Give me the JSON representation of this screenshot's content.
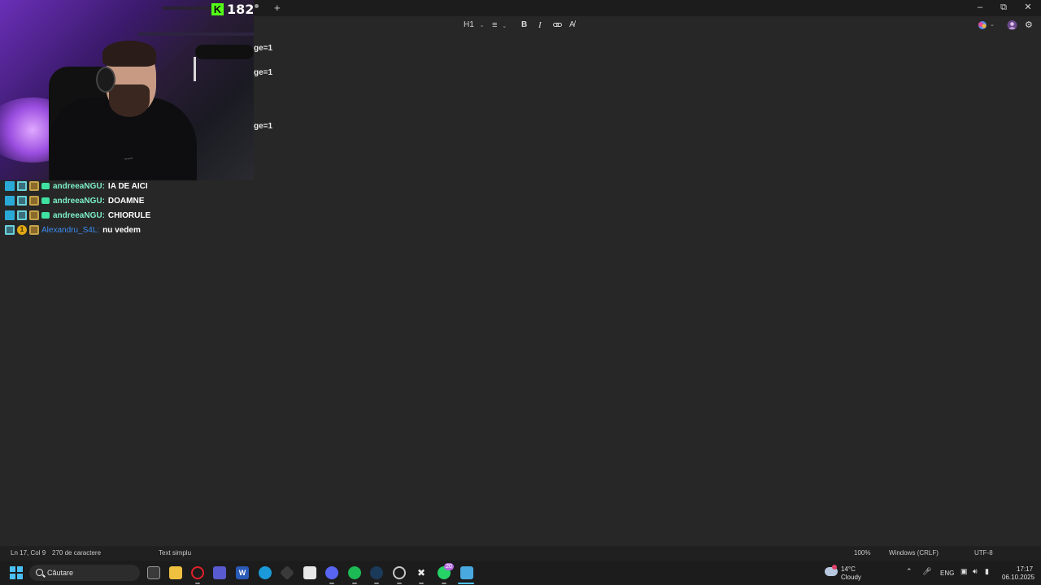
{
  "stream_overlay": {
    "viewer_count": "182",
    "chat": [
      {
        "user": "andreeaNGU",
        "message": "IA DE AICI",
        "badges": [
          "mod",
          "sub",
          "gift",
          "bot"
        ]
      },
      {
        "user": "andreeaNGU",
        "message": "DOAMNE",
        "badges": [
          "mod",
          "sub",
          "gift",
          "bot"
        ]
      },
      {
        "user": "andreeaNGU",
        "message": "CHIORULE",
        "badges": [
          "mod",
          "sub",
          "gift",
          "bot"
        ]
      },
      {
        "user": "Alexandru_S4L",
        "message": "nu vedem",
        "badges": [
          "sub",
          "vip-1",
          "gift"
        ]
      }
    ],
    "vip_badge_number": "1"
  },
  "toolbar": {
    "heading_label": "H1"
  },
  "editor": {
    "lines": [
      "ge=1",
      "ge=1",
      "ge=1"
    ]
  },
  "statusbar": {
    "cursor_position": "Ln 17, Col 9",
    "char_count": "270 de caractere",
    "format": "Text simplu",
    "zoom": "100%",
    "line_ending": "Windows (CRLF)",
    "encoding": "UTF-8"
  },
  "taskbar": {
    "search_placeholder": "Căutare",
    "weather_temp": "14°C",
    "weather_desc": "Cloudy",
    "language": "ENG",
    "time": "17:17",
    "date": "06.10.2025",
    "whatsapp_badge": "20"
  },
  "colors": {
    "editor_bg": "#272727",
    "kick_green": "#53fc18",
    "chat_user_green": "#7ef0c8",
    "chat_user_blue": "#3c8cf0"
  }
}
